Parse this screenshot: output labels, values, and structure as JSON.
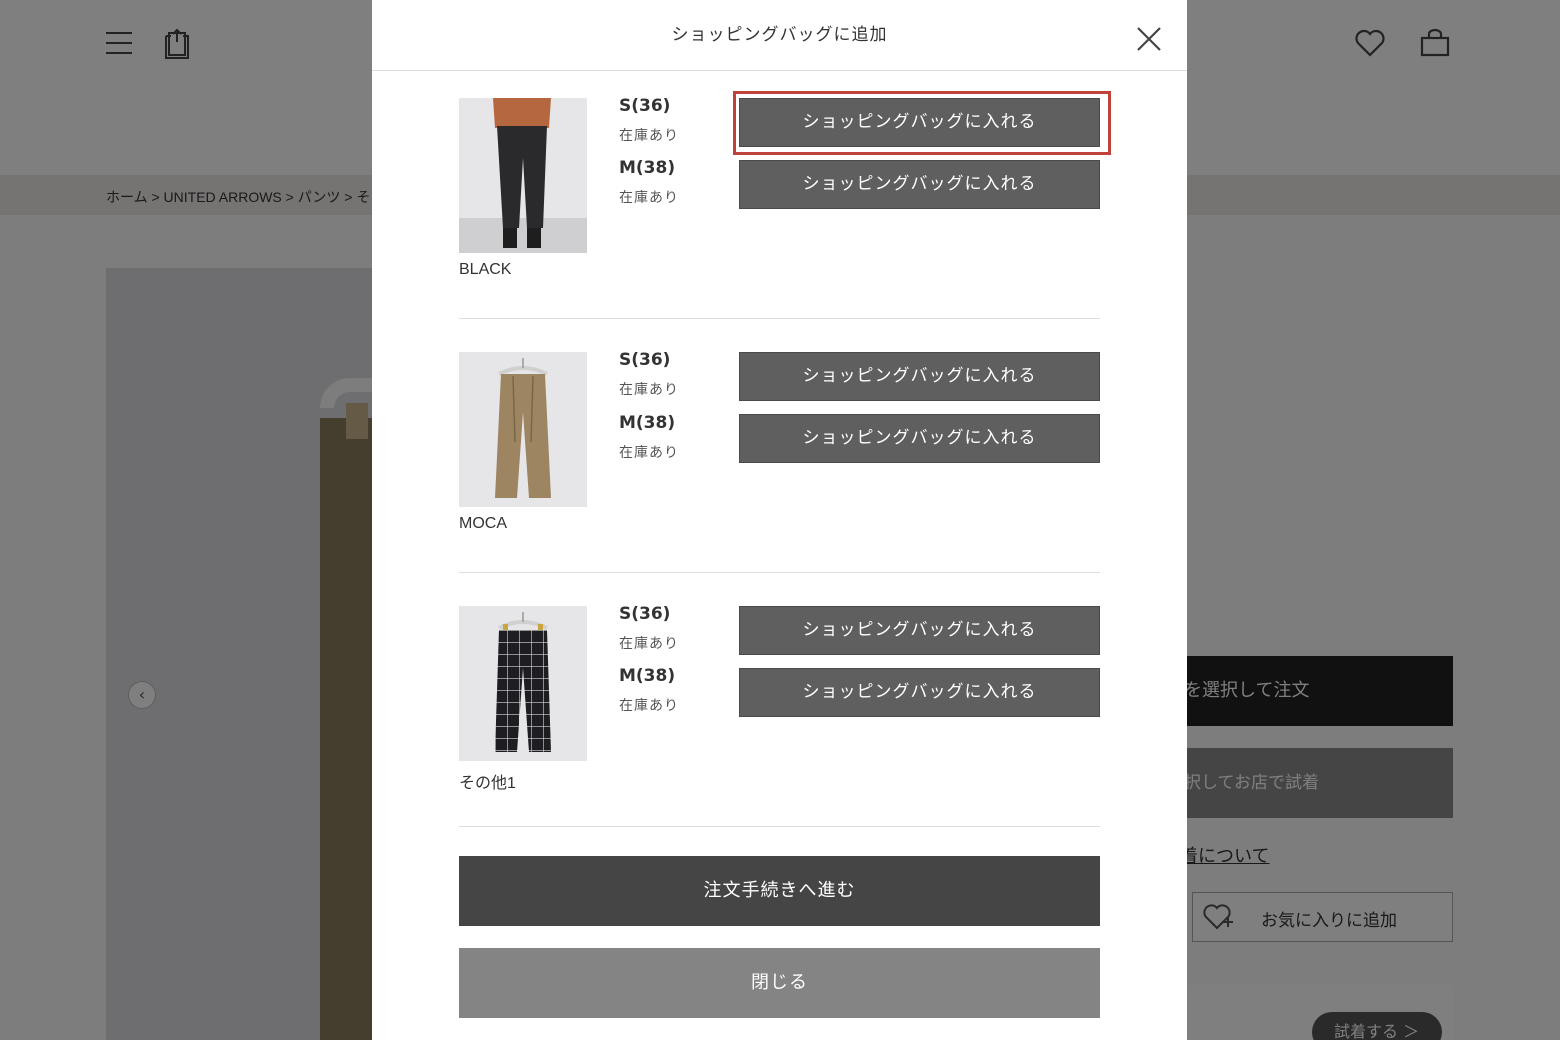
{
  "background": {
    "breadcrumb": "ホーム > UNITED ARROWS > パンツ > そ",
    "right_buttons": {
      "order_label": "を選択して注文",
      "store_try_label": "択してお店で試着",
      "try_link_label": "着について",
      "favorite_label": "お気に入りに追加",
      "fitting_label": "試着する ＞"
    },
    "icons": {
      "menu": "menu-icon",
      "share": "share-icon",
      "favorite": "heart-icon",
      "cart": "bag-icon",
      "prev": "chevron-left-icon"
    },
    "prev_glyph": "‹"
  },
  "modal": {
    "title": "ショッピングバッグに追加",
    "colors": [
      {
        "name": "BLACK",
        "sizes": [
          {
            "size": "S(36)",
            "stock": "在庫あり",
            "button": "ショッピングバッグに入れる"
          },
          {
            "size": "M(38)",
            "stock": "在庫あり",
            "button": "ショッピングバッグに入れる"
          }
        ]
      },
      {
        "name": "MOCA",
        "sizes": [
          {
            "size": "S(36)",
            "stock": "在庫あり",
            "button": "ショッピングバッグに入れる"
          },
          {
            "size": "M(38)",
            "stock": "在庫あり",
            "button": "ショッピングバッグに入れる"
          }
        ]
      },
      {
        "name": "その他1",
        "sizes": [
          {
            "size": "S(36)",
            "stock": "在庫あり",
            "button": "ショッピングバッグに入れる"
          },
          {
            "size": "M(38)",
            "stock": "在庫あり",
            "button": "ショッピングバッグに入れる"
          }
        ]
      }
    ],
    "checkout_label": "注文手続きへ進む",
    "close_label": "閉じる"
  },
  "colors": {
    "button_grey": "#5f5f5f",
    "checkout": "#454545",
    "close": "#848484",
    "highlight": "#c0433b"
  }
}
